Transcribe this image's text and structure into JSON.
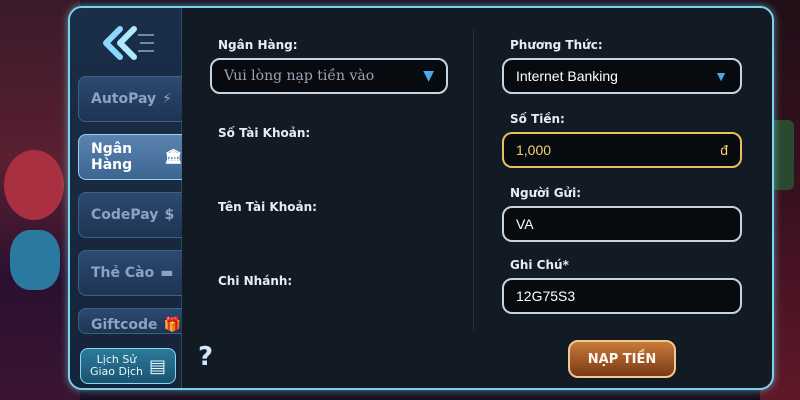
{
  "sidebar": {
    "items": [
      {
        "label": "AutoPay",
        "icon": "⚡",
        "icon_name": "lightning-icon"
      },
      {
        "label": "Ngân Hàng",
        "icon": "🏛",
        "icon_name": "bank-icon"
      },
      {
        "label": "CodePay",
        "icon": "$",
        "icon_name": "coin-icon"
      },
      {
        "label": "Thẻ Cào",
        "icon": "▬",
        "icon_name": "card-icon"
      },
      {
        "label": "Giftcode",
        "icon": "🎁",
        "icon_name": "gift-icon"
      }
    ],
    "history_label_line1": "Lịch Sử",
    "history_label_line2": "Giao Dịch",
    "help": "?"
  },
  "form": {
    "bank_label": "Ngân Hàng:",
    "bank_placeholder": "Vui lòng nạp tiền vào",
    "account_number_label": "Số Tài Khoản:",
    "account_name_label": "Tên Tài Khoản:",
    "branch_label": "Chi Nhánh:",
    "method_label": "Phương Thức:",
    "method_value": "Internet Banking",
    "amount_label": "Số Tiền:",
    "amount_value": "1,000",
    "currency": "đ",
    "sender_label": "Người Gửi:",
    "sender_value": "VA",
    "note_label": "Ghi Chú*",
    "note_value": "12G75S3",
    "submit_label": "NẠP TIỀN"
  },
  "colors": {
    "accent": "#7ad4e8",
    "amount": "#f5d070",
    "submit": "#c87a3a"
  }
}
